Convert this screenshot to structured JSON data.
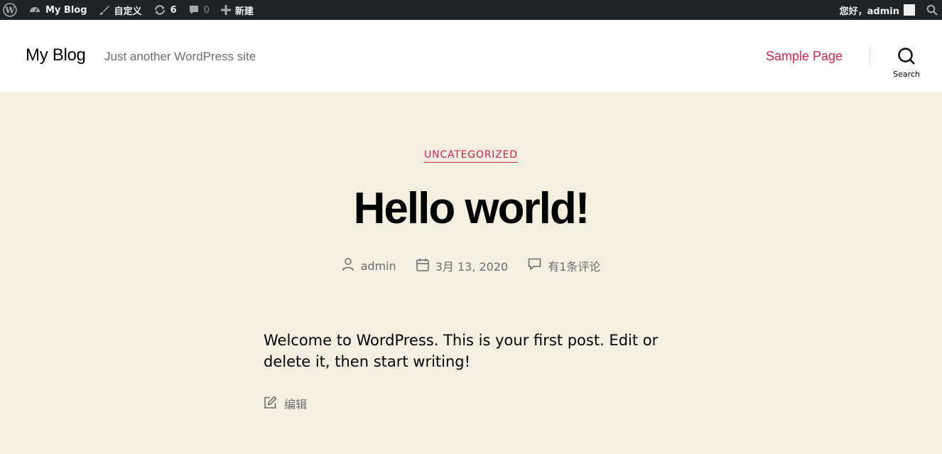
{
  "adminbar": {
    "wp_logo_icon": "wordpress-logo-icon",
    "site_name": "My Blog",
    "customize_label": "自定义",
    "updates_count": "6",
    "comments_count": "0",
    "new_label": "新建",
    "greeting": "您好，admin",
    "search_icon": "search-icon"
  },
  "header": {
    "site_title": "My Blog",
    "site_description": "Just another WordPress site",
    "nav": [
      {
        "label": "Sample Page"
      }
    ],
    "search_label": "Search"
  },
  "post": {
    "category": "UNCATEGORIZED",
    "title": "Hello world!",
    "author": "admin",
    "date": "3月 13, 2020",
    "comments": "有1条评论",
    "content": "Welcome to WordPress. This is your first post. Edit or delete it, then start writing!",
    "edit_label": "编辑"
  },
  "colors": {
    "accent": "#cd2653",
    "background": "#f5efe0",
    "adminbar": "#1d2327"
  }
}
